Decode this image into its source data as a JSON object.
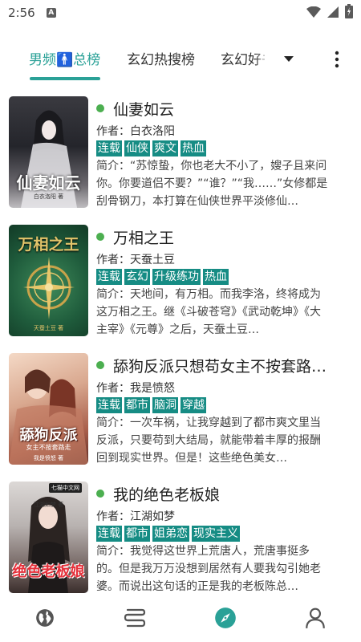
{
  "status_bar": {
    "time": "2:56",
    "notification_badge": "A",
    "icons": [
      "wifi-icon",
      "signal-icon",
      "battery-icon"
    ]
  },
  "tabs": [
    {
      "label": "男频🚹总榜",
      "active": true
    },
    {
      "label": "玄幻热搜榜",
      "active": false
    },
    {
      "label": "玄幻好书",
      "active": false
    }
  ],
  "colors": {
    "accent": "#2aa197",
    "tag_bg": "#168c84",
    "dot": "#4caf50"
  },
  "books": [
    {
      "title": "仙妻如云",
      "author_label": "作者：",
      "author": "白衣洛阳",
      "tags": [
        "连载",
        "仙侠",
        "爽文",
        "热血"
      ],
      "intro_label": "简介：",
      "intro": "“苏惊蛰，你也老大不小了，嫂子且来问你。你要道侣不要？”“谁？”“我……”女修都是刮骨钢刀，本打算在仙侠世界平淡修仙…",
      "cover_text": "仙妻如云",
      "cover_author": "白衣洛阳 著"
    },
    {
      "title": "万相之王",
      "author_label": "作者：",
      "author": "天蚕土豆",
      "tags": [
        "连载",
        "玄幻",
        "升级练功",
        "热血"
      ],
      "intro_label": "简介：",
      "intro": "天地间，有万相。而我李洛，终将成为这万相之王。继《斗破苍穹》《武动乾坤》《大主宰》《元尊》之后，天蚕土豆…",
      "cover_text": "万相之王",
      "cover_author": "天蚕土豆 著"
    },
    {
      "title": "舔狗反派只想苟女主不按套路出牌",
      "author_label": "作者：",
      "author": "我是愤怒",
      "tags": [
        "连载",
        "都市",
        "脑洞",
        "穿越"
      ],
      "intro_label": "简介：",
      "intro": "一次车祸，让我穿越到了都市爽文里当反派，只要苟到大结局，就能带着丰厚的报酬回到现实世界。但是！这些绝色美女…",
      "cover_text": "舔狗反派",
      "cover_sub": "女主不按套路走",
      "cover_author": "我是愤怒 著"
    },
    {
      "title": "我的绝色老板娘",
      "author_label": "作者：",
      "author": "江湖如梦",
      "tags": [
        "连载",
        "都市",
        "姐弟恋",
        "现实主义"
      ],
      "intro_label": "简介：",
      "intro": "我觉得这世界上荒唐人，荒唐事挺多的。但是我万万没想到居然有人要我勾引她老婆。而说出这句话的正是我的老板陈总…",
      "cover_text": "绝色老板娘",
      "cover_badge": "七猫中文网",
      "cover_author": "江湖如梦 著"
    }
  ],
  "bottom_nav": [
    {
      "name": "globe-icon"
    },
    {
      "name": "bookshelf-icon"
    },
    {
      "name": "compass-icon",
      "active": true
    },
    {
      "name": "person-icon"
    }
  ]
}
